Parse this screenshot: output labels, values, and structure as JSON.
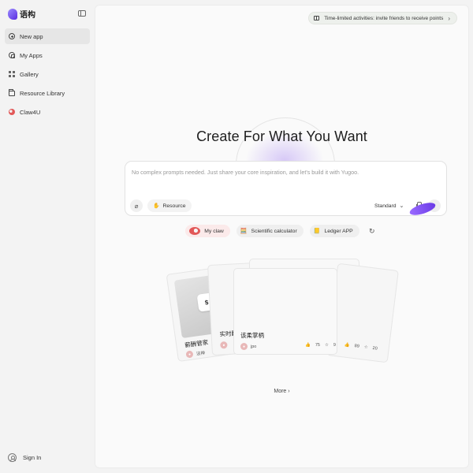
{
  "brand": {
    "name": "语构"
  },
  "sidebar": {
    "items": [
      {
        "label": "New app",
        "icon": "plus-circle-icon"
      },
      {
        "label": "My Apps",
        "icon": "apps-icon"
      },
      {
        "label": "Gallery",
        "icon": "grid-icon"
      },
      {
        "label": "Resource Library",
        "icon": "folder-icon"
      },
      {
        "label": "Claw4U",
        "icon": "claw-icon"
      }
    ],
    "sign_in": "Sign In"
  },
  "promo": {
    "text": "Time-limited activities: invite friends to receive points"
  },
  "hero": {
    "title": "Create For What You Want"
  },
  "prompt": {
    "placeholder": "No complex prompts needed. Just share your core inspiration, and let's build it with Yugoo.",
    "resource_label": "Resource",
    "mode_label": "Standard"
  },
  "suggestions": [
    {
      "label": "My claw",
      "icon": "claw-icon"
    },
    {
      "label": "Scientific calculator",
      "icon": "🧮"
    },
    {
      "label": "Ledger APP",
      "icon": "📒"
    }
  ],
  "cards": [
    {
      "title": "薪酬管家",
      "author": "法神",
      "badge": "$"
    },
    {
      "title": "实时翻",
      "author": ""
    },
    {
      "title": "该柔掌柄",
      "author": "jpo",
      "likes": "75",
      "stars": "9"
    },
    {
      "title": "",
      "author": "",
      "likes": "89",
      "stars": "20"
    }
  ],
  "more": {
    "label": "More"
  },
  "colors": {
    "accent": "#7a4cf0",
    "claw": "#e25858"
  }
}
